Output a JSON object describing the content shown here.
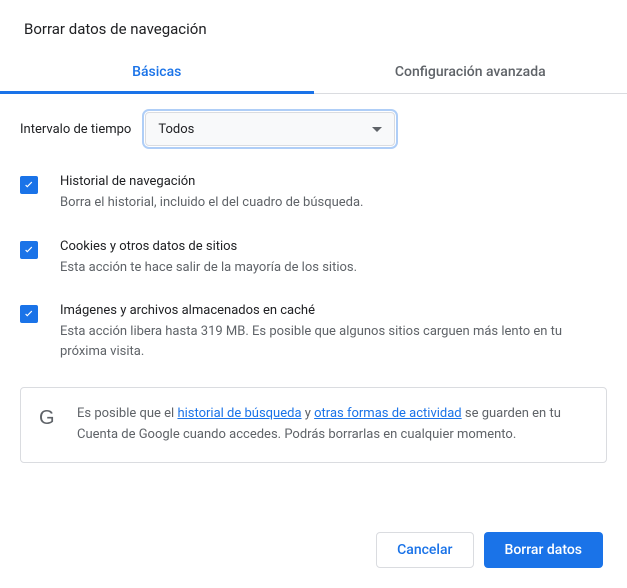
{
  "dialog": {
    "title": "Borrar datos de navegación"
  },
  "tabs": {
    "basic": "Básicas",
    "advanced": "Configuración avanzada"
  },
  "time": {
    "label": "Intervalo de tiempo",
    "value": "Todos"
  },
  "items": [
    {
      "title": "Historial de navegación",
      "desc": "Borra el historial, incluido el del cuadro de búsqueda.",
      "checked": true
    },
    {
      "title": "Cookies y otros datos de sitios",
      "desc": "Esta acción te hace salir de la mayoría de los sitios.",
      "checked": true
    },
    {
      "title": "Imágenes y archivos almacenados en caché",
      "desc": "Esta acción libera hasta 319 MB. Es posible que algunos sitios carguen más lento en tu próxima visita.",
      "checked": true
    }
  ],
  "info": {
    "pre": "Es posible que el ",
    "link1": "historial de búsqueda",
    "mid": " y ",
    "link2": "otras formas de actividad",
    "post": " se guarden en tu Cuenta de Google cuando accedes. Podrás borrarlas en cualquier momento."
  },
  "buttons": {
    "cancel": "Cancelar",
    "clear": "Borrar datos"
  }
}
